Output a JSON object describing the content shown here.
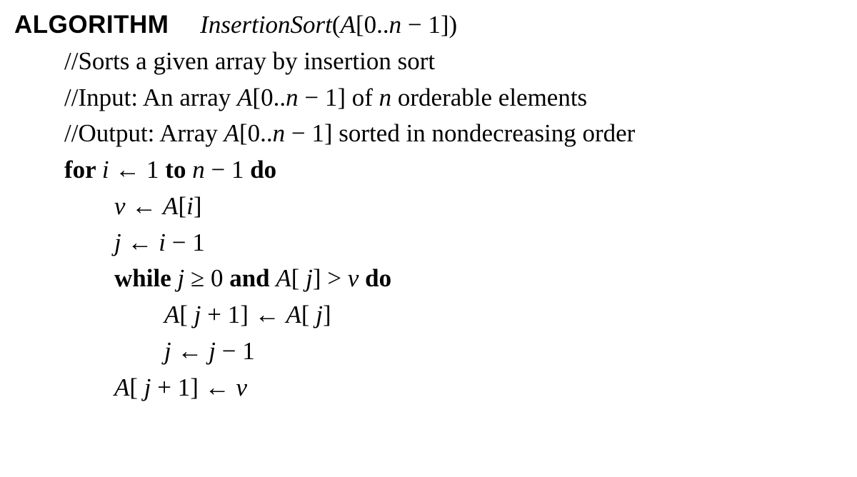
{
  "title": {
    "keyword": "ALGORITHM",
    "name_call": "InsertionSort",
    "arg_open": "(",
    "arg_A": "A",
    "arg_br_open": "[",
    "arg_range": "0..",
    "arg_n": "n",
    "arg_minus": " − 1",
    "arg_br_close": "]",
    "arg_close": ")"
  },
  "comments": {
    "c1": "//Sorts a given array by insertion sort",
    "c2_pre": "//Input: An array ",
    "c2_A": "A",
    "c2_bo": "[",
    "c2_range": "0..",
    "c2_n": "n",
    "c2_tail": " − 1]",
    "c2_mid": " of ",
    "c2_n2": "n",
    "c2_post": " orderable elements",
    "c3_pre": "//Output: Array ",
    "c3_A": "A",
    "c3_bo": "[",
    "c3_range": "0..",
    "c3_n": "n",
    "c3_tail": " − 1]",
    "c3_post": " sorted in nondecreasing order"
  },
  "forline": {
    "for": "for ",
    "i": "i",
    "arrow": " ← ",
    "one": "1",
    "to": " to ",
    "n": "n",
    "minus1": " − 1",
    "do": " do"
  },
  "l_v": {
    "v": "v",
    "arrow": " ← ",
    "A": "A",
    "bo": "[",
    "i": "i",
    "bc": "]"
  },
  "l_j": {
    "j": "j",
    "arrow": " ← ",
    "i": "i",
    "minus1": " − 1"
  },
  "whileline": {
    "while": "while ",
    "j": " j",
    "geq": " ≥ ",
    "zero": "0",
    "and": " and ",
    "A": "A",
    "bo": "[",
    "j2": " j",
    "bc": "]",
    "gt": " > ",
    "v": "v",
    "do": " do"
  },
  "w_shift": {
    "A1": "A",
    "bo1": "[",
    "j1": " j",
    "plus1": " + 1",
    "bc1": "]",
    "arrow": " ← ",
    "A2": "A",
    "bo2": "[",
    "j2": " j",
    "bc2": "]"
  },
  "w_dec": {
    "j": "j",
    "arrow": " ← ",
    "j2": "j",
    "minus1": " − 1"
  },
  "l_place": {
    "A": "A",
    "bo": "[",
    "j": " j",
    "plus1": " + 1",
    "bc": "]",
    "arrow": " ← ",
    "v": "v"
  }
}
